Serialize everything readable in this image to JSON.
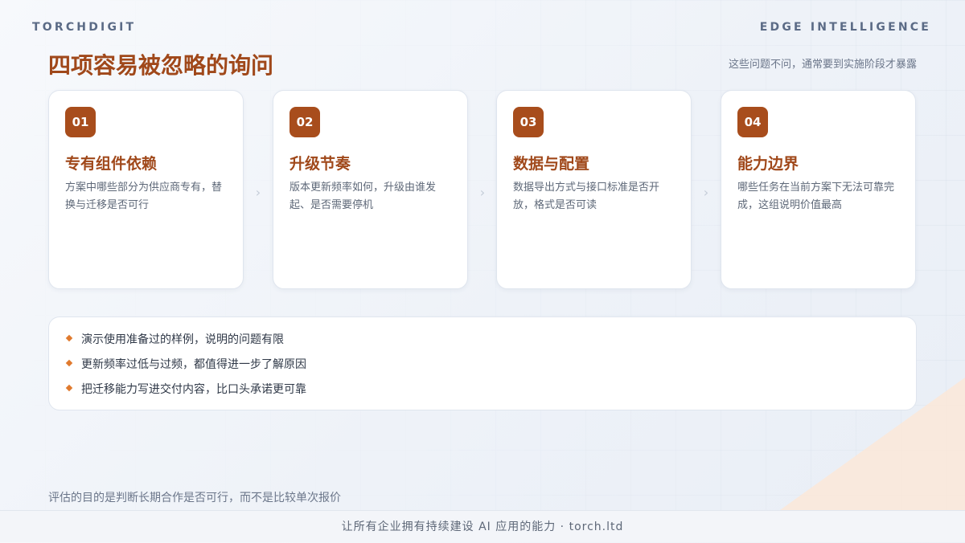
{
  "header": {
    "brand_left": "TORCHDIGIT",
    "brand_right": "EDGE INTELLIGENCE"
  },
  "main": {
    "title": "四项容易被忽略的询问",
    "subtitle": "这些问题不问，通常要到实施阶段才暴露"
  },
  "cards": [
    {
      "num": "01",
      "title": "专有组件依赖",
      "desc": "方案中哪些部分为供应商专有，替换与迁移是否可行"
    },
    {
      "num": "02",
      "title": "升级节奏",
      "desc": "版本更新频率如何，升级由谁发起、是否需要停机"
    },
    {
      "num": "03",
      "title": "数据与配置",
      "desc": "数据导出方式与接口标准是否开放，格式是否可读"
    },
    {
      "num": "04",
      "title": "能力边界",
      "desc": "哪些任务在当前方案下无法可靠完成，这组说明价值最高"
    }
  ],
  "chevron": "›",
  "notes": [
    "演示使用准备过的样例，说明的问题有限",
    "更新频率过低与过频，都值得进一步了解原因",
    "把迁移能力写进交付内容，比口头承诺更可靠"
  ],
  "footnote": "评估的目的是判断长期合作是否可行，而不是比较单次报价",
  "footer": "让所有企业拥有持续建设 AI 应用的能力 · torch.ltd",
  "colors": {
    "accent": "#a84d1c",
    "title": "#a0481a",
    "bullet": "#e07a2e",
    "corner": "#fbe8d8"
  }
}
